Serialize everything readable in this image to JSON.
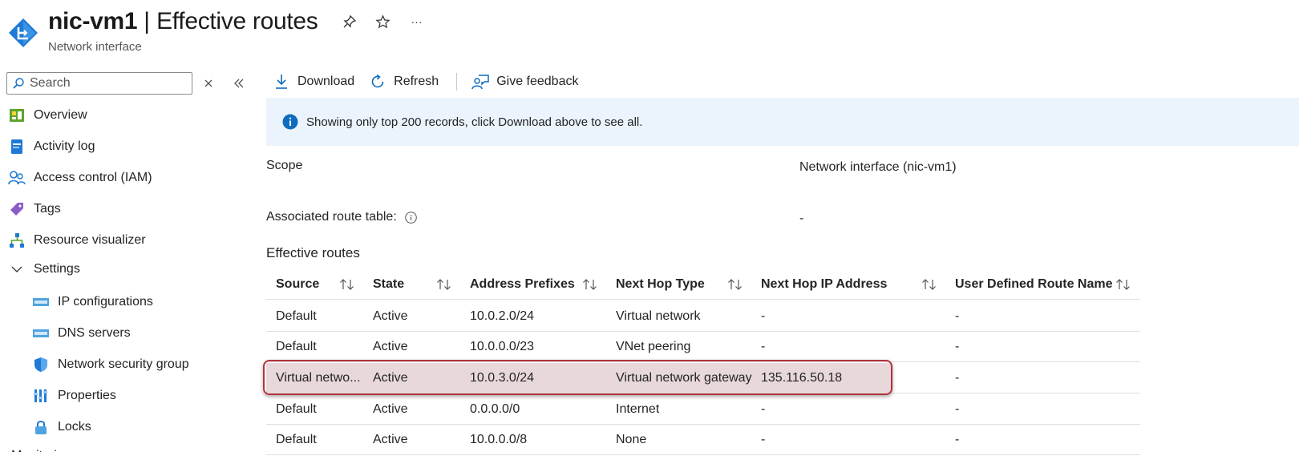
{
  "header": {
    "resource_name": "nic-vm1",
    "separator": "|",
    "page_title": "Effective routes",
    "subtitle": "Network interface",
    "actions": [
      "pin-icon",
      "star-icon",
      "more-icon"
    ],
    "more_label": "···"
  },
  "sidebar": {
    "search_placeholder": "Search",
    "items": [
      {
        "label": "Overview",
        "icon": "overview-icon"
      },
      {
        "label": "Activity log",
        "icon": "activity-log-icon"
      },
      {
        "label": "Access control (IAM)",
        "icon": "iam-icon"
      },
      {
        "label": "Tags",
        "icon": "tag-icon"
      },
      {
        "label": "Resource visualizer",
        "icon": "visualizer-icon"
      },
      {
        "label": "Settings",
        "icon": "chevron-down-icon"
      }
    ],
    "settings_items": [
      {
        "label": "IP configurations",
        "icon": "ip-config-icon"
      },
      {
        "label": "DNS servers",
        "icon": "dns-icon"
      },
      {
        "label": "Network security group",
        "icon": "shield-icon"
      },
      {
        "label": "Properties",
        "icon": "properties-icon"
      },
      {
        "label": "Locks",
        "icon": "lock-icon"
      }
    ],
    "next_group_label": "Monitoring"
  },
  "toolbar": {
    "download_label": "Download",
    "refresh_label": "Refresh",
    "feedback_label": "Give feedback"
  },
  "info_bar": {
    "message": "Showing only top 200 records, click Download above to see all."
  },
  "fields": {
    "scope_label": "Scope",
    "scope_value": "Network interface (nic-vm1)",
    "route_table_label": "Associated route table:",
    "route_table_value": "-"
  },
  "routes": {
    "section_title": "Effective routes",
    "columns": [
      "Source",
      "State",
      "Address Prefixes",
      "Next Hop Type",
      "Next Hop IP Address",
      "User Defined Route Name"
    ],
    "rows": [
      {
        "source": "Default",
        "state": "Active",
        "prefix": "10.0.2.0/24",
        "hop_type": "Virtual network",
        "hop_ip": "-",
        "udr": "-"
      },
      {
        "source": "Default",
        "state": "Active",
        "prefix": "10.0.0.0/23",
        "hop_type": "VNet peering",
        "hop_ip": "-",
        "udr": "-"
      },
      {
        "source": "Virtual netwo...",
        "state": "Active",
        "prefix": "10.0.3.0/24",
        "hop_type": "Virtual network gateway",
        "hop_ip": "135.116.50.18",
        "udr": "-"
      },
      {
        "source": "Default",
        "state": "Active",
        "prefix": "0.0.0.0/0",
        "hop_type": "Internet",
        "hop_ip": "-",
        "udr": "-"
      },
      {
        "source": "Default",
        "state": "Active",
        "prefix": "10.0.0.0/8",
        "hop_type": "None",
        "hop_ip": "-",
        "udr": "-"
      }
    ]
  },
  "colors": {
    "accent": "#0f6cbd",
    "info_bg": "#ebf3fc",
    "highlight_bg": "#e8d8da",
    "highlight_border": "#b4323c"
  }
}
